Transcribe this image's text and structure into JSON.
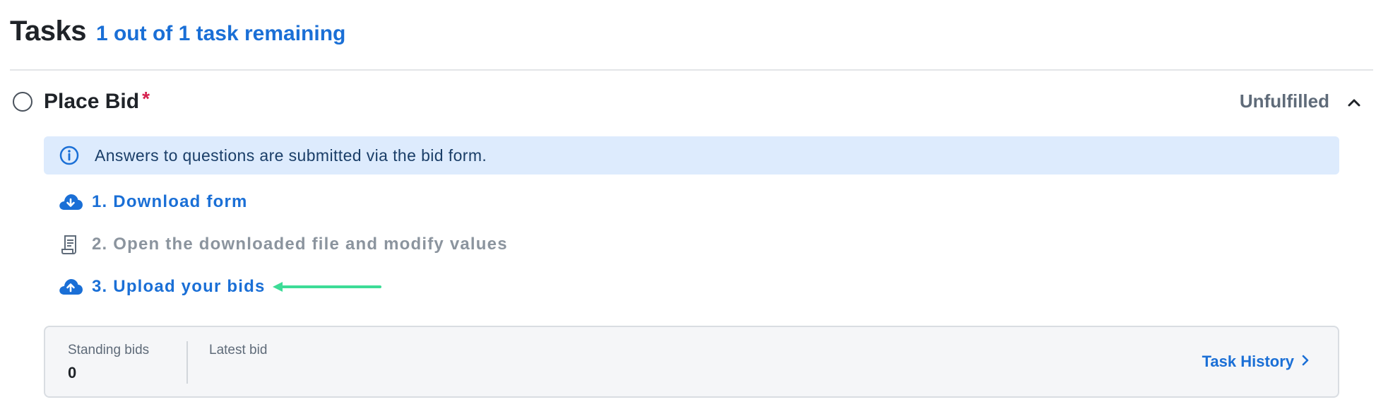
{
  "header": {
    "title": "Tasks",
    "remaining": "1 out of 1 task remaining"
  },
  "task": {
    "name": "Place Bid",
    "required_mark": "*",
    "status": "Unfulfilled",
    "expanded": true
  },
  "info_banner": {
    "icon": "info-icon",
    "text": "Answers to questions are submitted via the bid form."
  },
  "steps": [
    {
      "label": "1. Download form",
      "icon": "cloud-download-icon",
      "enabled": true
    },
    {
      "label": "2. Open the downloaded file and modify values",
      "icon": "document-icon",
      "enabled": false
    },
    {
      "label": "3. Upload your bids",
      "icon": "cloud-upload-icon",
      "enabled": true
    }
  ],
  "stats": {
    "standing_bids_label": "Standing bids",
    "standing_bids_value": "0",
    "latest_bid_label": "Latest bid",
    "latest_bid_value": ""
  },
  "task_history": {
    "label": "Task History"
  },
  "colors": {
    "accent": "#1a6fd6",
    "required": "#d6204e",
    "banner_bg": "#ddebfd",
    "annotation_arrow": "#3ddc97"
  }
}
